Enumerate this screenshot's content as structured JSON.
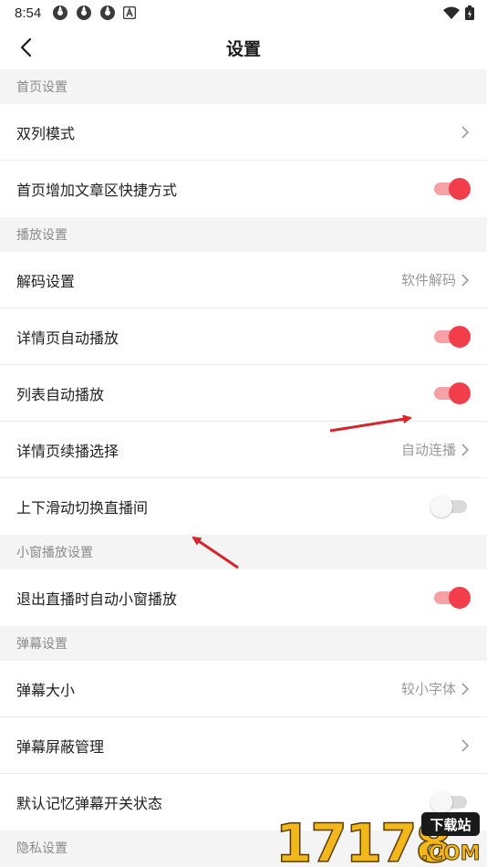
{
  "status": {
    "time": "8:54"
  },
  "header": {
    "title": "设置"
  },
  "sections": {
    "home": {
      "title": "首页设置",
      "double_column": "双列模式",
      "shortcut": "首页增加文章区快捷方式"
    },
    "playback": {
      "title": "播放设置",
      "decode": "解码设置",
      "decode_value": "软件解码",
      "detail_autoplay": "详情页自动播放",
      "list_autoplay": "列表自动播放",
      "continue_play": "详情页续播选择",
      "continue_value": "自动连播",
      "swipe_switch": "上下滑动切换直播间"
    },
    "mini": {
      "title": "小窗播放设置",
      "exit_mini": "退出直播时自动小窗播放"
    },
    "danmaku": {
      "title": "弹幕设置",
      "size": "弹幕大小",
      "size_value": "较小字体",
      "block": "弹幕屏蔽管理",
      "remember": "默认记忆弹幕开关状态"
    },
    "privacy": {
      "title": "隐私设置"
    }
  },
  "toggles": {
    "shortcut": true,
    "detail_autoplay": true,
    "list_autoplay": true,
    "swipe_switch": false,
    "exit_mini": true,
    "remember": false
  },
  "watermark": {
    "text": "17178",
    "badge": "下载站",
    "domain": ".COM"
  },
  "colors": {
    "accent": "#f23d4b",
    "arrow": "#d7262b"
  }
}
